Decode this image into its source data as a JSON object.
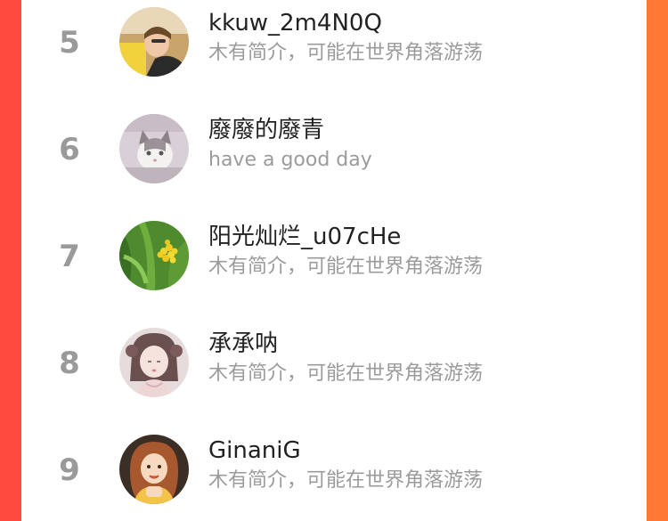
{
  "ranking": {
    "items": [
      {
        "rank": "5",
        "name": "kkuw_2m4N0Q",
        "bio": "木有简介，可能在世界角落游荡",
        "avatar_icon": "girl-lying-photo-avatar"
      },
      {
        "rank": "6",
        "name": "廢廢的廢青",
        "bio": "have a good day",
        "avatar_icon": "white-cat-avatar"
      },
      {
        "rank": "7",
        "name": "阳光灿烂_u07cHe",
        "bio": "木有简介，可能在世界角落游荡",
        "avatar_icon": "yellow-flower-avatar"
      },
      {
        "rank": "8",
        "name": "承承呐",
        "bio": "木有简介，可能在世界角落游荡",
        "avatar_icon": "illustrated-girl-avatar"
      },
      {
        "rank": "9",
        "name": "GinaniG",
        "bio": "木有简介，可能在世界角落游荡",
        "avatar_icon": "cartoon-girl-avatar"
      }
    ]
  },
  "colors": {
    "background_gradient_start": "#ff4a3f",
    "background_gradient_end": "#ff7a35",
    "rank_color": "#9a9a9a",
    "name_color": "#222222",
    "bio_color": "#9b9b9b"
  }
}
